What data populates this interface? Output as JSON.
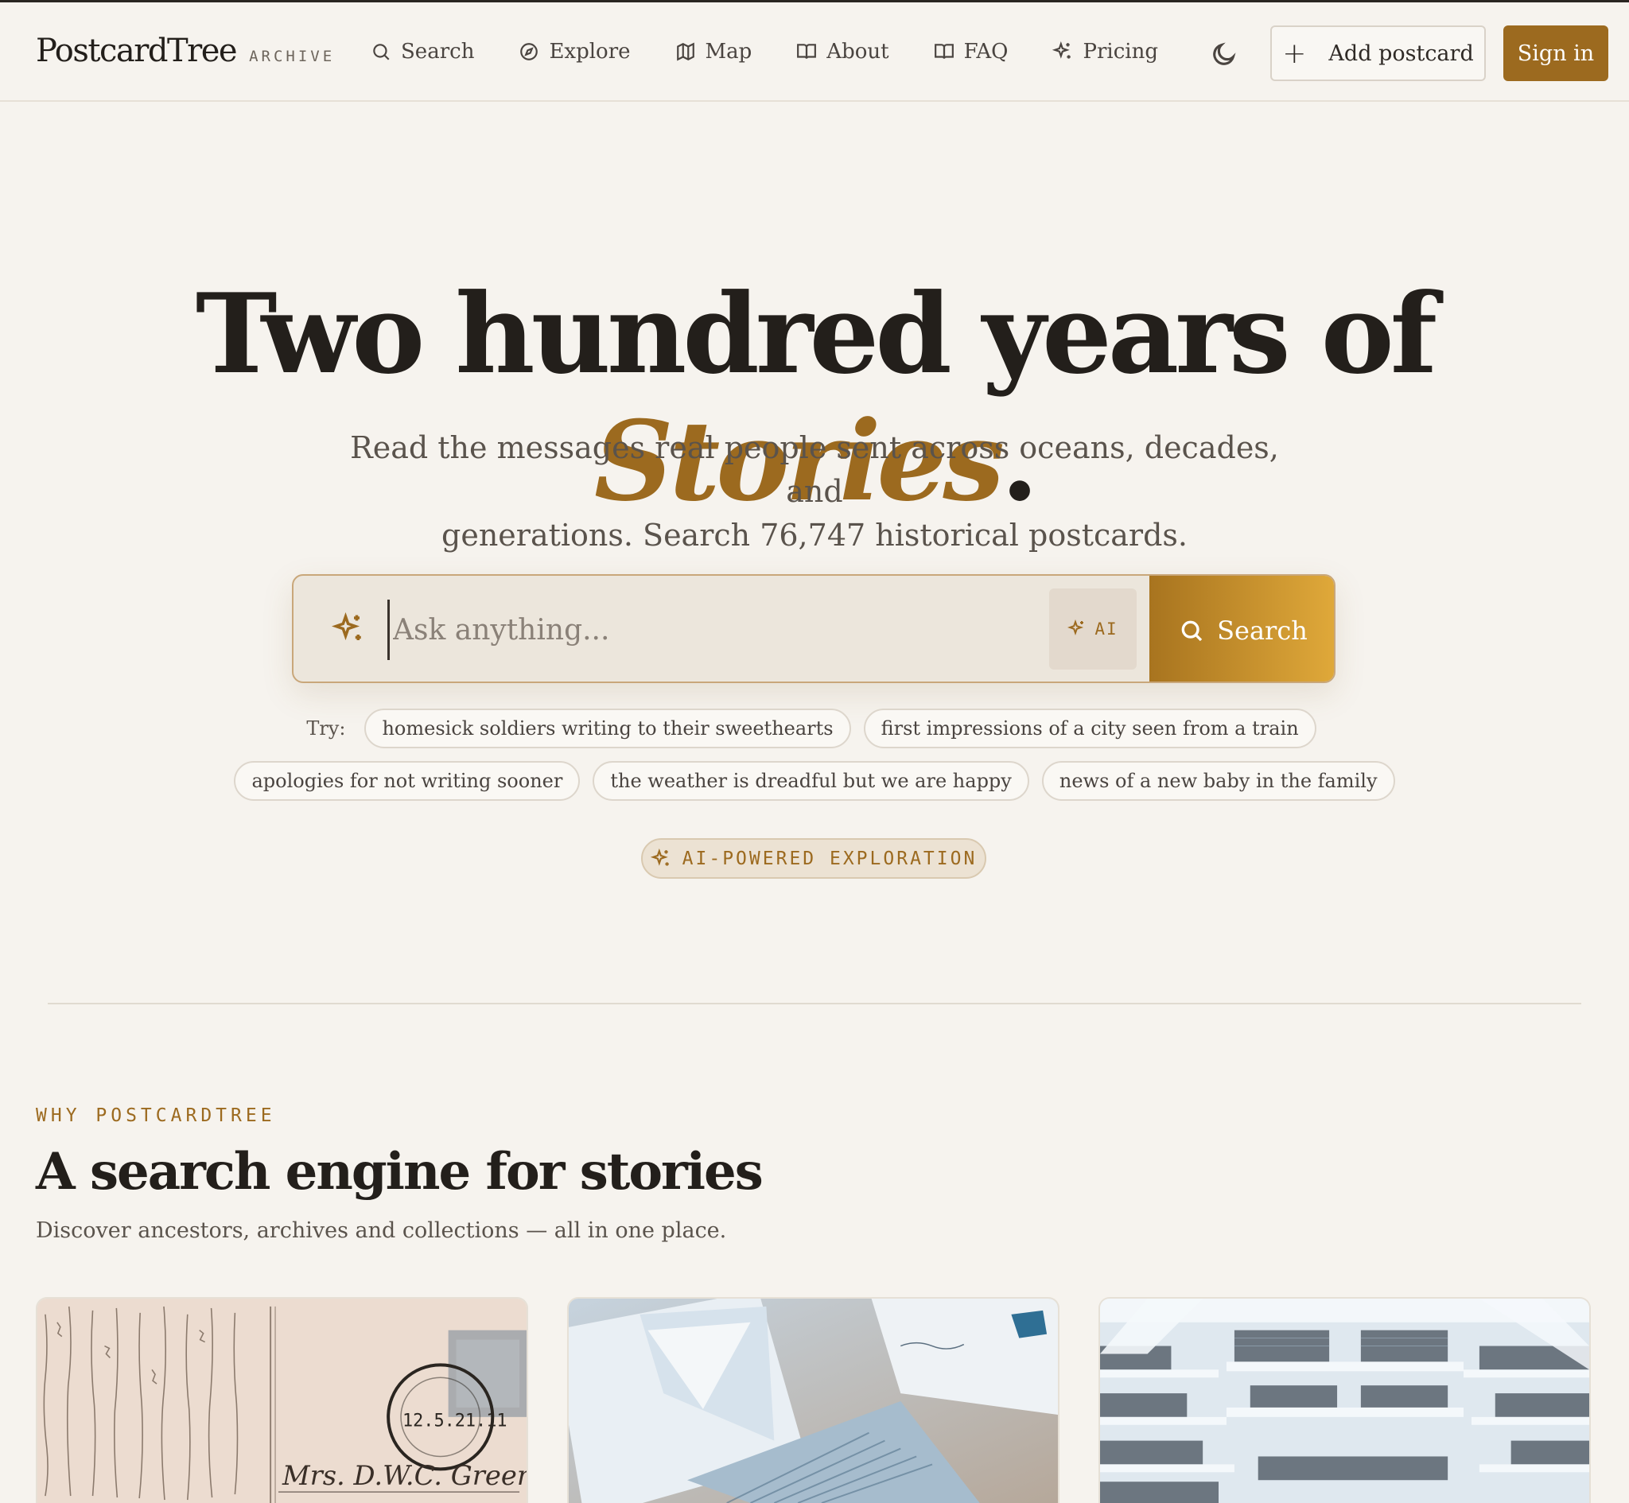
{
  "nav": {
    "logo": "PostcardTree",
    "logo_tag": "ARCHIVE",
    "links": [
      "Search",
      "Explore",
      "Map",
      "About",
      "FAQ",
      "Pricing"
    ],
    "add_label": "Add postcard",
    "signin_label": "Sign in"
  },
  "hero": {
    "title_main": "Two hundred years of ",
    "title_accent": "Stories",
    "title_end": ".",
    "subtitle_line1": "Read the messages real people sent across oceans, decades, and",
    "subtitle_line2": "generations. Search 76,747 historical postcards."
  },
  "search": {
    "placeholder": "Ask anything...",
    "ai_label": "AI",
    "button_label": "Search"
  },
  "suggestions": {
    "try_label": "Try:",
    "chips": [
      "homesick soldiers writing to their sweethearts",
      "first impressions of a city seen from a train",
      "apologies for not writing sooner",
      "the weather is dreadful but we are happy",
      "news of a new baby in the family"
    ]
  },
  "ai_badge": "AI-POWERED EXPLORATION",
  "why": {
    "eyebrow": "WHY POSTCARDTREE",
    "title": "A search engine for stories",
    "subtitle": "Discover ancestors, archives and collections — all in one place."
  },
  "cards": {
    "postmark_text": "12.5.21.11",
    "address_text": "Mrs. D.W.C. Greene"
  },
  "colors": {
    "accent": "#9c6a1f",
    "background": "#f6f3ee",
    "ink": "#231f1b"
  },
  "icons": [
    "search-icon",
    "compass-icon",
    "map-icon",
    "book-icon",
    "book-icon",
    "sparkle-icon",
    "moon-icon",
    "plus-icon",
    "sparkle-icon"
  ]
}
